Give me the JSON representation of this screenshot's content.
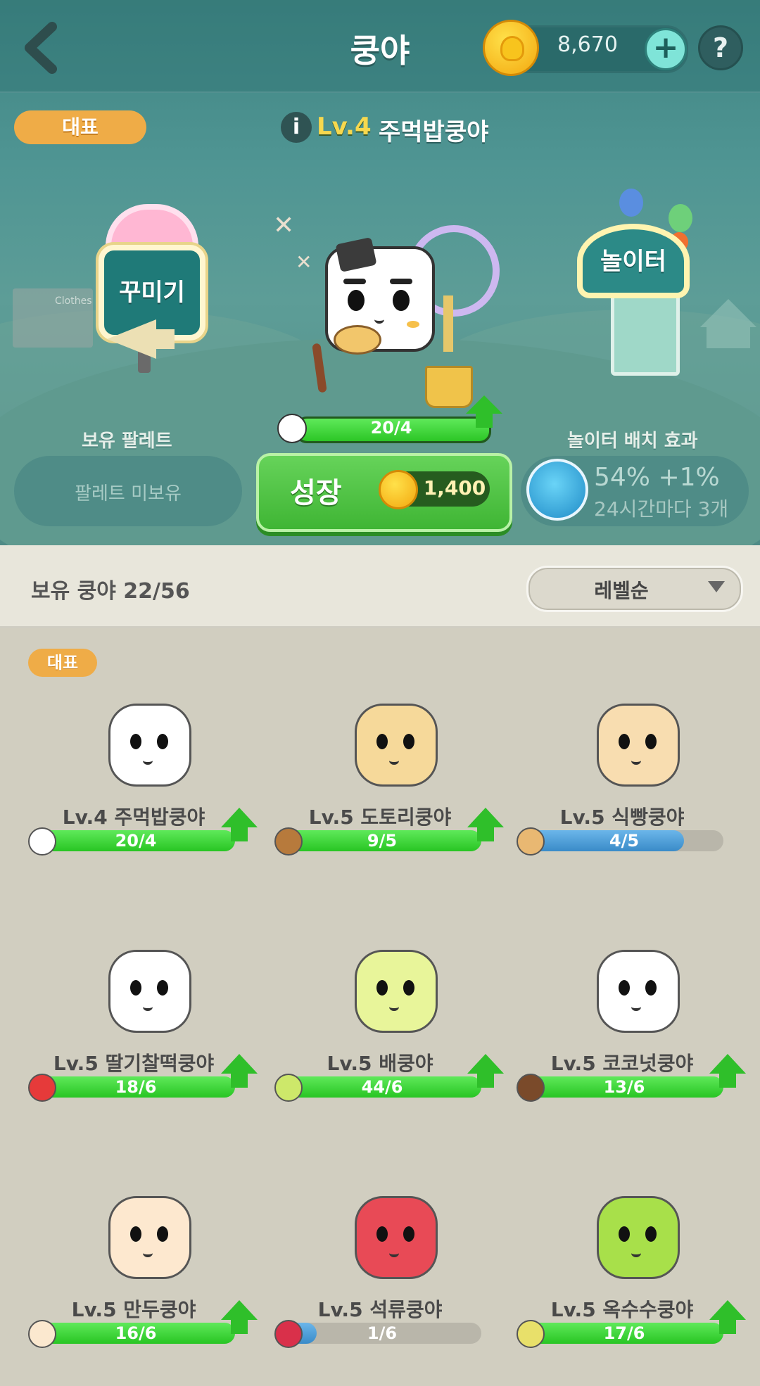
{
  "header": {
    "title": "쿵야",
    "coins": "8,670",
    "plus": "+",
    "help": "?"
  },
  "representative": {
    "badge": "대표",
    "info": "i",
    "level": "Lv.4",
    "name": "주먹밥쿵야"
  },
  "scene": {
    "decorate_sign": "꾸미기",
    "playground_sign": "놀이터",
    "shop_sign": "Clothes",
    "progress_text": "20/4",
    "progress_fraction": 1.0
  },
  "palette": {
    "label": "보유 팔레트",
    "value": "팔레트 미보유"
  },
  "grow": {
    "label": "성장",
    "cost": "1,400"
  },
  "playground_effect": {
    "label": "놀이터 배치 효과",
    "line1": "54% +1%",
    "line2": "24시간마다 3개"
  },
  "list": {
    "owned": "보유 쿵야 22/56",
    "sort": "레벨순",
    "rep_badge": "대표"
  },
  "characters": [
    {
      "level": "Lv.4",
      "name": "주먹밥쿵야",
      "progress": "20/4",
      "fraction": 1.0,
      "can_grow": true,
      "color": "#ffffff",
      "icon_color": "#ffffff"
    },
    {
      "level": "Lv.5",
      "name": "도토리쿵야",
      "progress": "9/5",
      "fraction": 1.0,
      "can_grow": true,
      "color": "#f6d99a",
      "icon_color": "#b77a3c"
    },
    {
      "level": "Lv.5",
      "name": "식빵쿵야",
      "progress": "4/5",
      "fraction": 0.8,
      "can_grow": false,
      "color": "#f8ddb0",
      "icon_color": "#e9b872"
    },
    {
      "level": "Lv.5",
      "name": "딸기찰떡쿵야",
      "progress": "18/6",
      "fraction": 1.0,
      "can_grow": true,
      "color": "#ffffff",
      "icon_color": "#e63a3a"
    },
    {
      "level": "Lv.5",
      "name": "배쿵야",
      "progress": "44/6",
      "fraction": 1.0,
      "can_grow": true,
      "color": "#e8f59a",
      "icon_color": "#cde86a"
    },
    {
      "level": "Lv.5",
      "name": "코코넛쿵야",
      "progress": "13/6",
      "fraction": 1.0,
      "can_grow": true,
      "color": "#ffffff",
      "icon_color": "#7a4a2a"
    },
    {
      "level": "Lv.5",
      "name": "만두쿵야",
      "progress": "16/6",
      "fraction": 1.0,
      "can_grow": true,
      "color": "#fde8cf",
      "icon_color": "#fbe8cf"
    },
    {
      "level": "Lv.5",
      "name": "석류쿵야",
      "progress": "1/6",
      "fraction": 0.17,
      "can_grow": false,
      "color": "#e84a56",
      "icon_color": "#d9304a"
    },
    {
      "level": "Lv.5",
      "name": "옥수수쿵야",
      "progress": "17/6",
      "fraction": 1.0,
      "can_grow": true,
      "color": "#a8e04a",
      "icon_color": "#e8e06a"
    }
  ]
}
